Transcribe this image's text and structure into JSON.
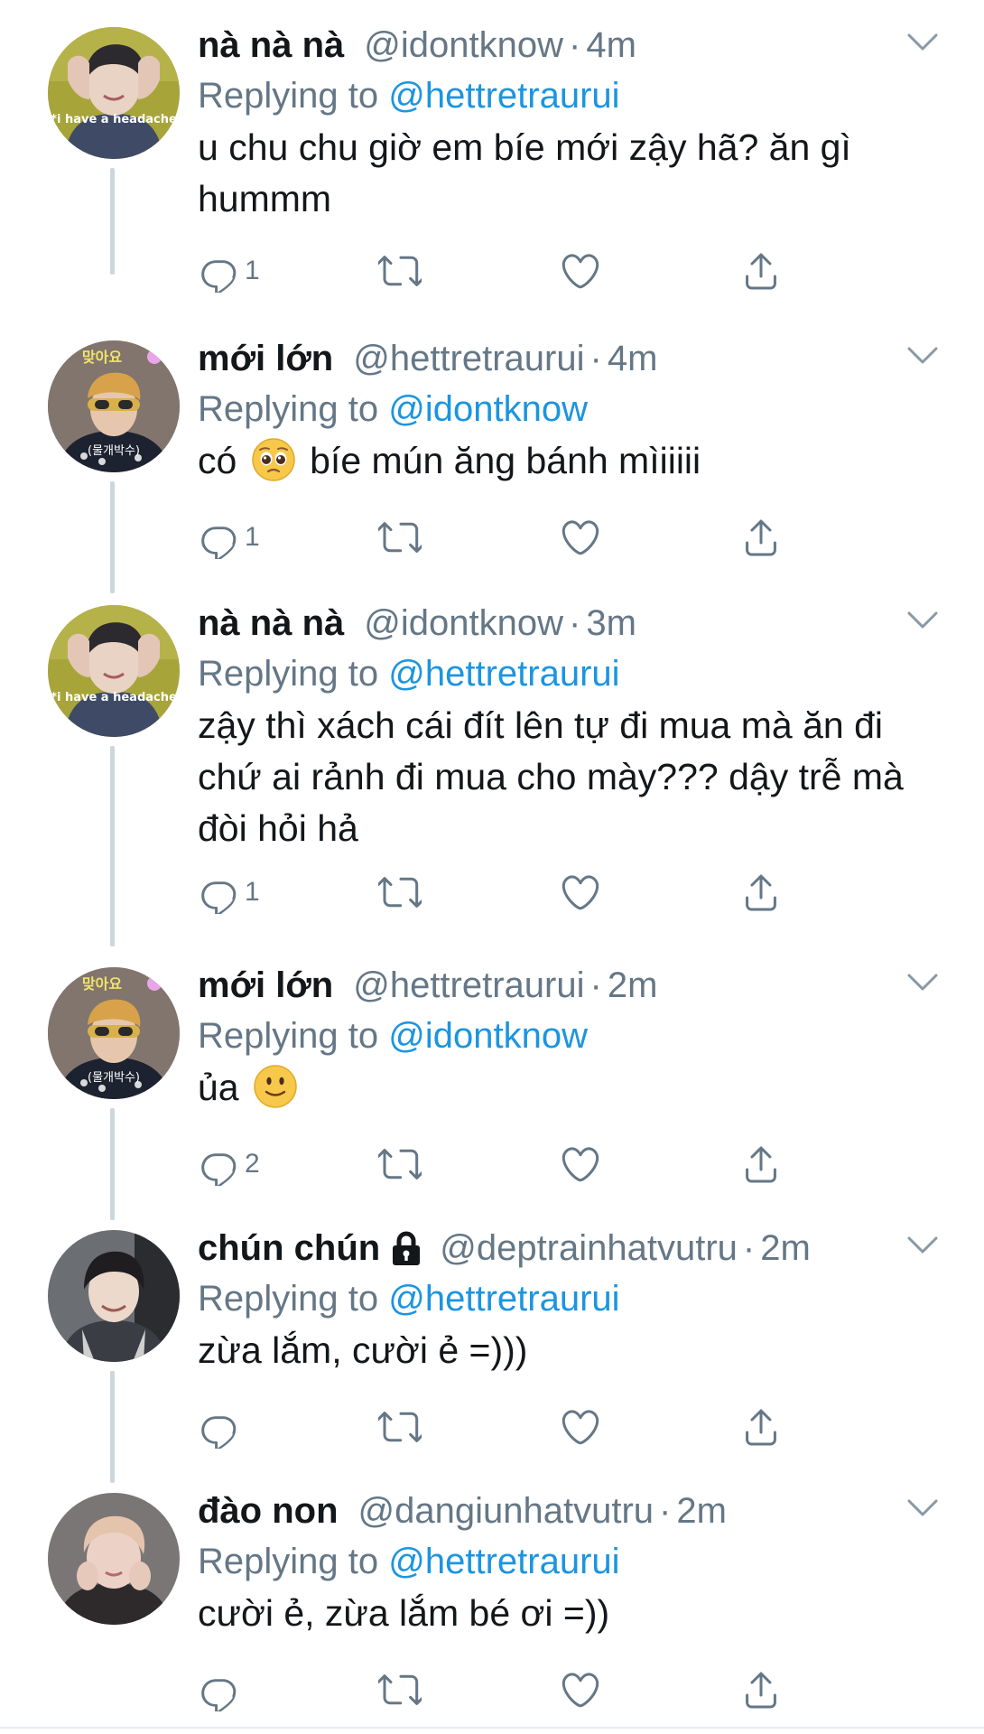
{
  "replying_prefix": "Replying to",
  "colors": {
    "link": "#1b95e0",
    "secondary": "#657786",
    "thread_line": "#ccd6dd"
  },
  "tweets": [
    {
      "name": "nà nà nà",
      "handle": "@idontknow",
      "time": "4m",
      "replying_to": "@hettretraurui",
      "text": "u chu chu giờ em bíe mới zậy hã? ăn gì hummm",
      "reply_count": "1",
      "avatar_caption": "*i have a headache"
    },
    {
      "name": "mới lớn",
      "handle": "@hettretraurui",
      "time": "4m",
      "replying_to": "@idontknow",
      "text_before": "có",
      "text_after": "bíe mún ăng bánh mìiiiii",
      "emoji": "pleading-face-emoji",
      "reply_count": "1",
      "avatar_caption_top": "맞아요",
      "avatar_caption_bottom": "(물개박수)"
    },
    {
      "name": "nà nà nà",
      "handle": "@idontknow",
      "time": "3m",
      "replying_to": "@hettretraurui",
      "text": "zậy thì xách cái đít lên tự đi mua mà ăn đi chứ ai rảnh đi mua cho mày??? dậy trễ mà đòi hỏi hả",
      "reply_count": "1",
      "avatar_caption": "*i have a headache"
    },
    {
      "name": "mới lớn",
      "handle": "@hettretraurui",
      "time": "2m",
      "replying_to": "@idontknow",
      "text_before": "ủa",
      "emoji": "slightly-smiling-face-emoji",
      "reply_count": "2",
      "avatar_caption_top": "맞아요",
      "avatar_caption_bottom": "(물개박수)"
    },
    {
      "name": "chún chún",
      "handle": "@deptrainhatvutru",
      "time": "2m",
      "replying_to": "@hettretraurui",
      "text": "zừa lắm, cười ẻ =)))",
      "reply_count": "",
      "protected": true
    },
    {
      "name": "đào non",
      "handle": "@dangiunhatvutru",
      "time": "2m",
      "replying_to": "@hettretraurui",
      "text": "cười ẻ, zừa lắm bé ơi =))",
      "reply_count": ""
    }
  ]
}
